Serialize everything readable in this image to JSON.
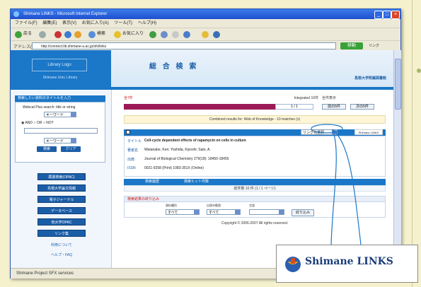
{
  "browser": {
    "title": "Shimane LINKS - Microsoft Internet Explorer",
    "menu": [
      "ファイル(F)",
      "編集(E)",
      "表示(V)",
      "お気に入り(A)",
      "ツール(T)",
      "ヘルプ(H)"
    ],
    "toolbar": {
      "back": "戻る",
      "search": "検索",
      "favorites": "お気に入り"
    },
    "address_label": "アドレス(D)",
    "address": "http://connect.lib.shimane-u.ac.jp/sfx/links",
    "go": "移動",
    "links_label": "リンク",
    "status": "Shimane Project SFX services"
  },
  "header": {
    "logo": "Library Logo",
    "logo_sub": "Shimane Univ. Library",
    "title": "総 合 検 索",
    "right_link": "島根大学附属図書館"
  },
  "sidebar": {
    "heading": "検索したい資料のタイトルを入力",
    "label": "Webcat Plus search: title or string",
    "select1": "キーワード",
    "radios": "◉ AND ○ OR ○ NOT",
    "select2": "キーワード",
    "search_btn": "検索",
    "clear_btn": "クリア",
    "nav": [
      "蔵書検索(OPAC)",
      "島根大学論文情報",
      "電子ジャーナル",
      "データベース",
      "他大学OPAC",
      "リンク集"
    ],
    "links": [
      "利用について",
      "ヘルプ・FAQ"
    ]
  },
  "main": {
    "results_label": "全7件",
    "results_right": "Integrated 10件　全件表示",
    "pager": "1 / 1",
    "btn_prev": "前の5件",
    "btn_next": "次の5件",
    "combined": "Combined results for: Web of Knowledge - 10 matches (s)",
    "record_select": "リンク先選択",
    "links_button": "Shimane LINKS",
    "record": [
      {
        "label": "タイトル",
        "value": "Cell-cycle dependent effects of rapamycin on cells in culture",
        "bold": true
      },
      {
        "label": "著者名",
        "value": "Watanabe, Ken; Yoshida, Kiyoshi; Sato, A."
      },
      {
        "label": "出典",
        "value": "Journal of Biological Chemistry 279(18): 18450-18455"
      },
      {
        "label": "ISSN",
        "value": "0021-9258 (Print) 1083-351X (Online)"
      }
    ],
    "history_head": "検索履歴　　　　　　　検索ヒット件数",
    "history_row": "総件数 10 件 (1 / 1 ページ)",
    "filter_head": "検索結果の絞り込み",
    "filter_labels": [
      "資料種別",
      "出版年範囲",
      "言語"
    ],
    "filter_values": [
      "すべて",
      "すべて"
    ],
    "filter_btn": "絞り込み",
    "copyright": "Copyright © 2006-2007 All rights reserved."
  },
  "callout": {
    "text": "Shimane LINKS"
  }
}
